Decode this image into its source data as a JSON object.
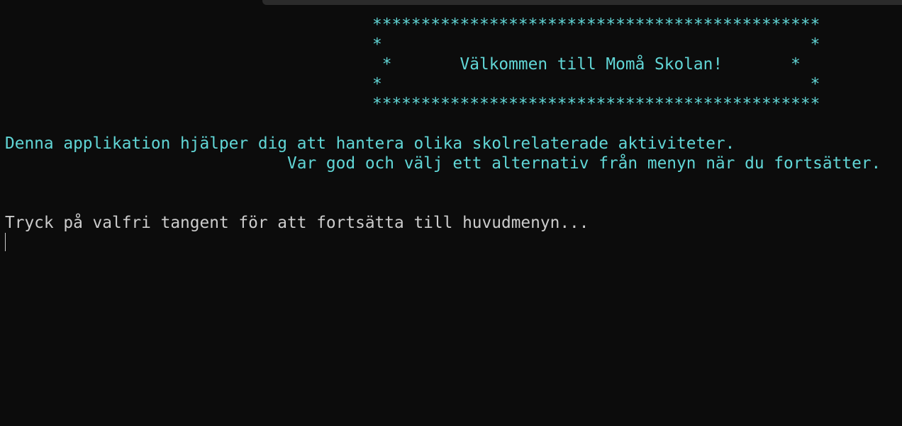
{
  "banner": {
    "border_top": "**********************************************",
    "side_top": "*                                            *",
    "welcome": " *       Välkommen till Momå Skolan!       *",
    "side_bottom": "*                                            *",
    "border_bottom": "**********************************************"
  },
  "intro": {
    "line1": "Denna applikation hjälper dig att hantera olika skolrelaterade aktiviteter.",
    "line2": "                             Var god och välj ett alternativ från menyn när du fortsätter."
  },
  "prompt": "Tryck på valfri tangent för att fortsätta till huvudmenyn...",
  "colors": {
    "background": "#0c0c0c",
    "cyan_text": "#61d6d6",
    "white_text": "#cccccc"
  }
}
